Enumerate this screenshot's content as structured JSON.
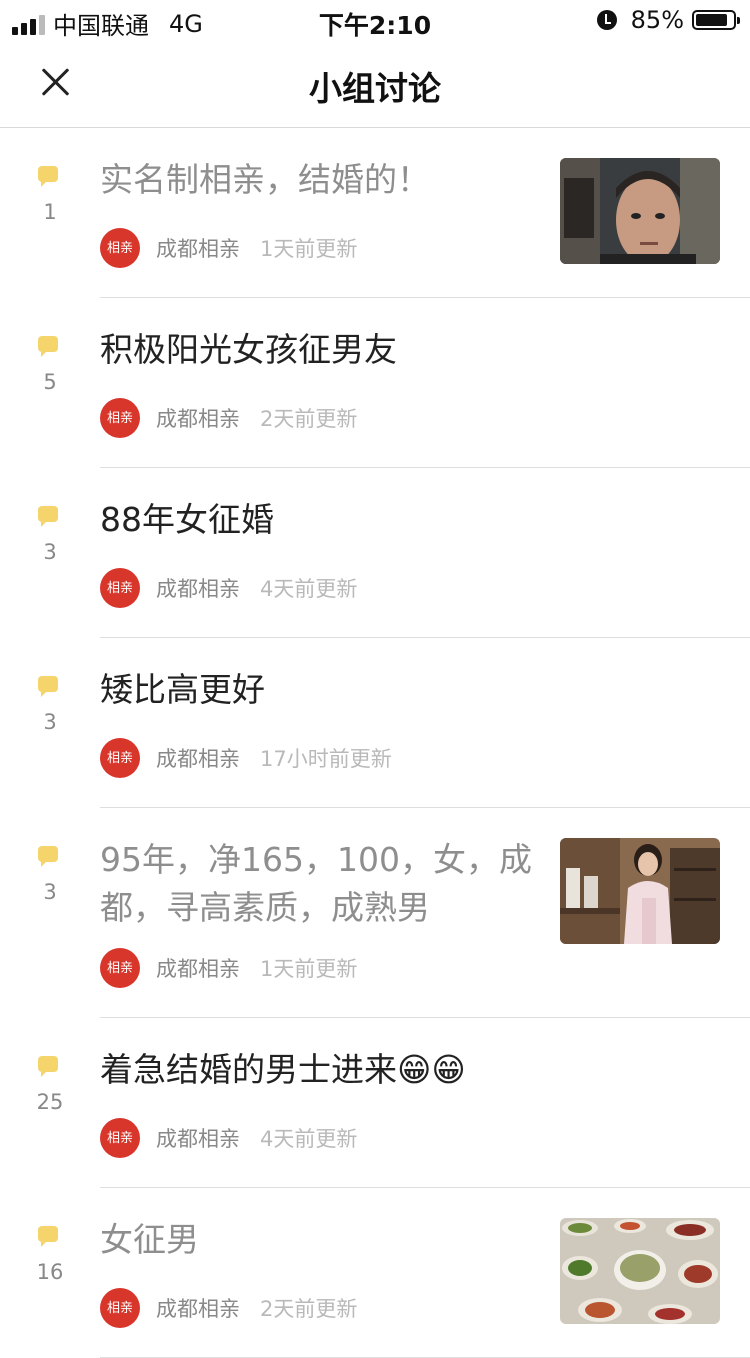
{
  "status_bar": {
    "carrier": "中国联通",
    "network": "4G",
    "time": "下午2:10",
    "battery_percent": "85%",
    "battery_level": 0.85,
    "signal_bars_on": 3,
    "signal_bars_total": 4
  },
  "nav": {
    "title": "小组讨论",
    "close_icon": "close-icon"
  },
  "colors": {
    "comment_icon": "#f5d56b",
    "avatar_bg": "#d9362b",
    "read_title": "#8e8e8e",
    "unread_title": "#222222",
    "meta_text": "#888888",
    "time_text": "#b9b9b9"
  },
  "avatar_text": "相亲",
  "avatar_small_text": "成都",
  "posts": [
    {
      "comments": "1",
      "title": "实名制相亲，结婚的！",
      "group": "成都相亲",
      "time": "1天前更新",
      "read": true,
      "thumbnail": "portrait-man"
    },
    {
      "comments": "5",
      "title": " 积极阳光女孩征男友",
      "group": "成都相亲",
      "time": "2天前更新",
      "read": false,
      "thumbnail": null
    },
    {
      "comments": "3",
      "title": "88年女征婚",
      "group": "成都相亲",
      "time": "4天前更新",
      "read": false,
      "thumbnail": null
    },
    {
      "comments": "3",
      "title": "矮比高更好",
      "group": "成都相亲",
      "time": "17小时前更新",
      "read": false,
      "thumbnail": null
    },
    {
      "comments": "3",
      "title": "95年，净165，100，女，成都，寻高素质，成熟男",
      "group": "成都相亲",
      "time": "1天前更新",
      "read": true,
      "thumbnail": "portrait-woman"
    },
    {
      "comments": "25",
      "title": "着急结婚的男士进来😁😁",
      "group": "成都相亲",
      "time": "4天前更新",
      "read": false,
      "thumbnail": null
    },
    {
      "comments": "16",
      "title": "女征男",
      "group": "成都相亲",
      "time": "2天前更新",
      "read": true,
      "thumbnail": "food-table"
    }
  ]
}
